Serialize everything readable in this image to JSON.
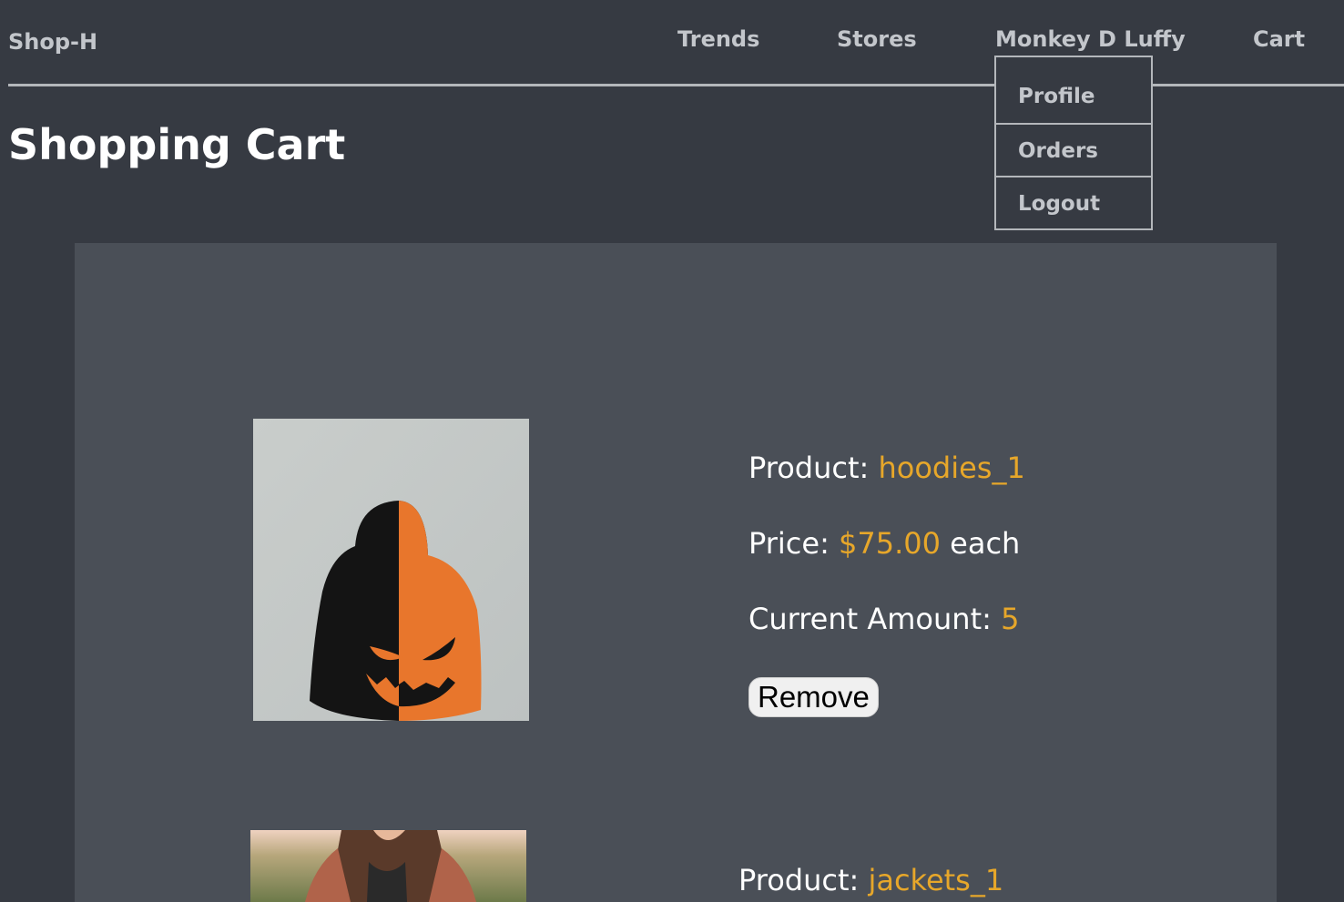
{
  "nav": {
    "brand": "Shop-H",
    "links": [
      "Trends",
      "Stores",
      "Monkey D Luffy",
      "Cart"
    ]
  },
  "user_menu": {
    "items": [
      "Profile",
      "Orders",
      "Logout"
    ]
  },
  "page": {
    "title": "Shopping Cart"
  },
  "labels": {
    "product": "Product:",
    "price": "Price:",
    "each": "each",
    "amount": "Current Amount:"
  },
  "cart_items": [
    {
      "product": "hoodies_1",
      "price": "$75.00",
      "amount": "5",
      "remove_label": "Remove",
      "image_icon": "hoodie-photo"
    },
    {
      "product": "jackets_1",
      "image_icon": "jacket-photo"
    }
  ],
  "colors": {
    "page_bg": "#363a42",
    "panel_bg": "#4a4f57",
    "accent": "#e7a72a",
    "nav_text": "#c3c6cb"
  }
}
